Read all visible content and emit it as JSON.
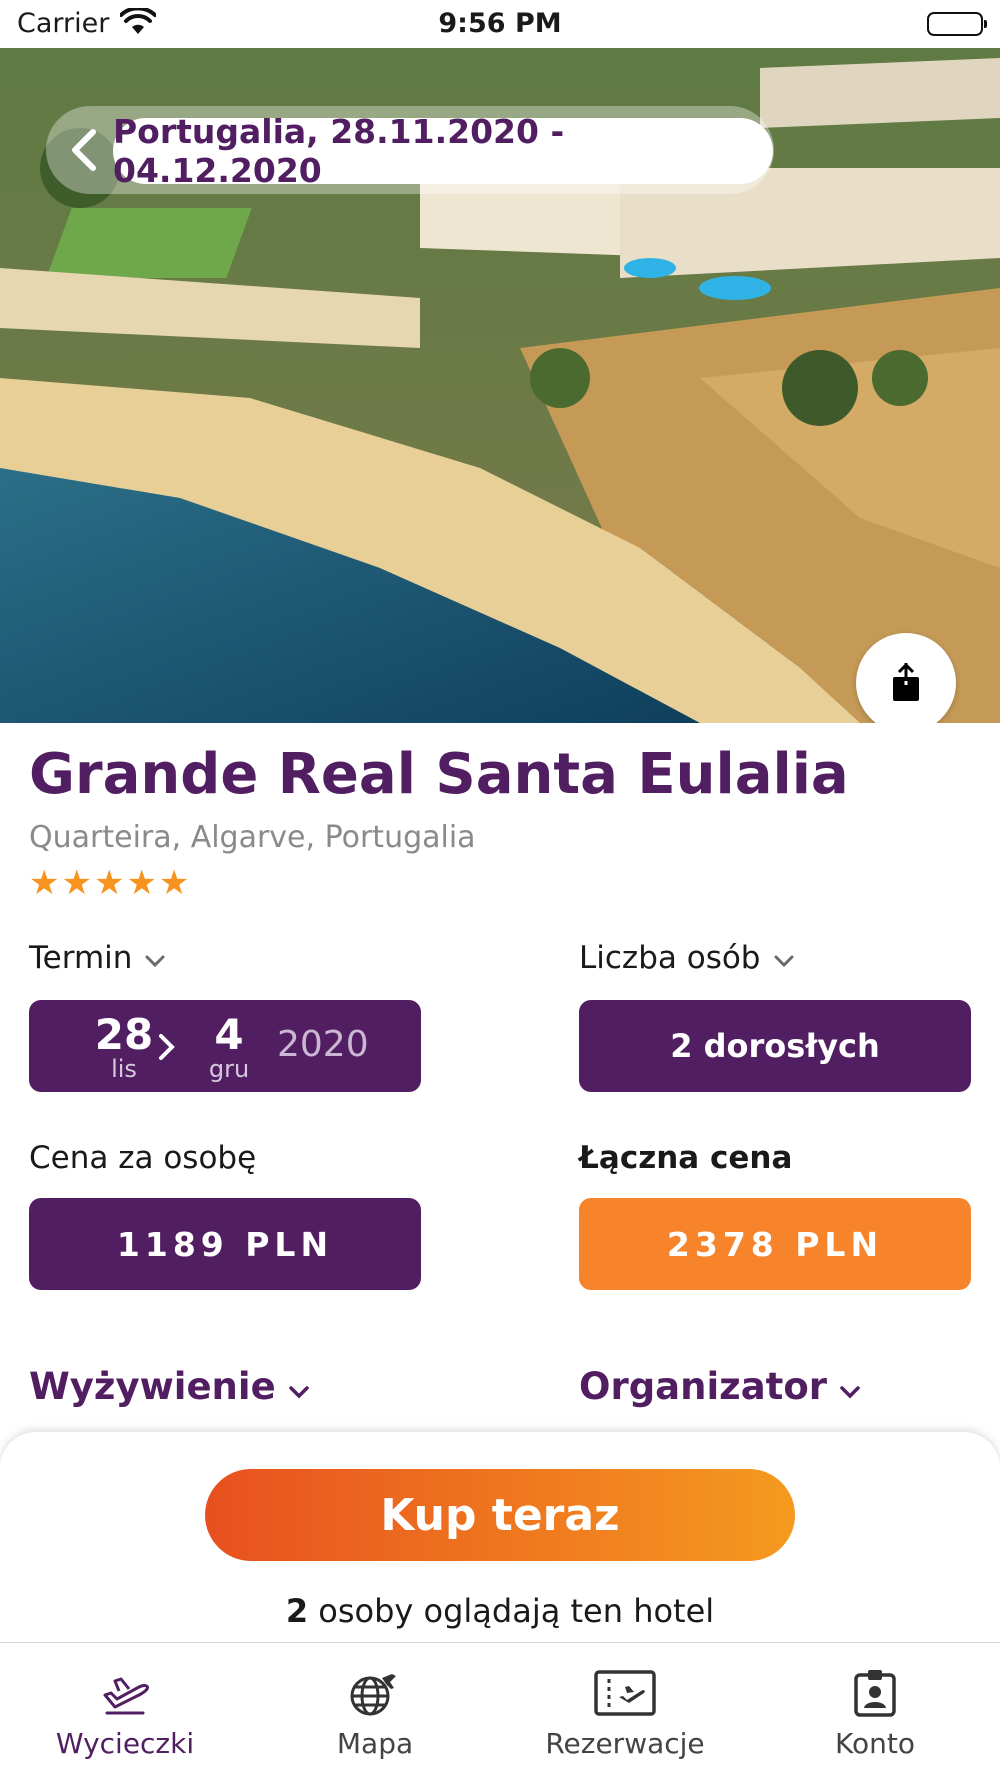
{
  "status_bar": {
    "carrier": "Carrier",
    "time": "9:56 PM"
  },
  "header": {
    "title": "Portugalia, 28.11.2020 - 04.12.2020"
  },
  "hotel": {
    "name": "Grande Real Santa Eulalia",
    "location": "Quarteira, Algarve, Portugalia",
    "stars": "★★★★★",
    "rating": 5
  },
  "term": {
    "label": "Termin",
    "from_day": "28",
    "from_month": "lis",
    "to_day": "4",
    "to_month": "gru",
    "year": "2020"
  },
  "persons": {
    "label": "Liczba osób",
    "value": "2 dorosłych"
  },
  "price_per_person": {
    "label": "Cena za osobę",
    "value": "1189 PLN"
  },
  "total_price": {
    "label": "Łączna cena",
    "value": "2378 PLN"
  },
  "sections": {
    "board": "Wyżywienie",
    "organizer": "Organizator"
  },
  "purchase": {
    "buy_label": "Kup teraz",
    "watchers_count": "2",
    "watchers_text": " osoby oglądają ten hotel"
  },
  "tabs": [
    {
      "label": "Wycieczki",
      "icon": "plane-icon",
      "active": true
    },
    {
      "label": "Mapa",
      "icon": "globe-icon",
      "active": false
    },
    {
      "label": "Rezerwacje",
      "icon": "ticket-icon",
      "active": false
    },
    {
      "label": "Konto",
      "icon": "badge-icon",
      "active": false
    }
  ],
  "colors": {
    "brand_purple": "#511e62",
    "accent_orange": "#f7842a",
    "star": "#f7931e"
  }
}
